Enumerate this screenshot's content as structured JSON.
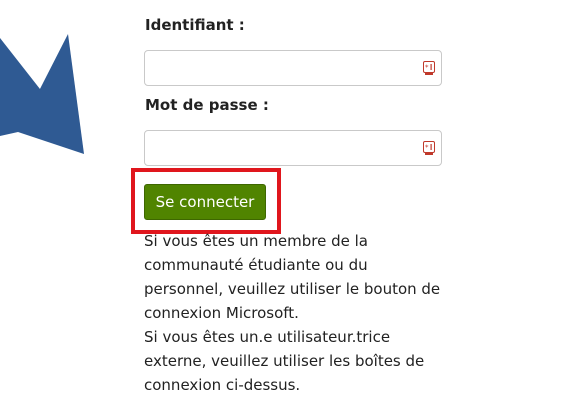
{
  "login": {
    "username_label": "Identifiant :",
    "username_value": "",
    "password_label": "Mot de passe :",
    "password_value": "",
    "field_icon": "key-badge-icon",
    "submit_label": "Se connecter"
  },
  "info": {
    "paragraph_1": "Si vous êtes un membre de la communauté étudiante ou du personnel, veuillez utiliser le bouton de connexion Microsoft.",
    "paragraph_2": "Si vous êtes un.e utilisateur.trice externe, veuillez utiliser les boîtes de connexion ci-dessus."
  },
  "colors": {
    "button_bg": "#508400",
    "highlight_border": "#e0161d",
    "arrow": "#2f5a93"
  }
}
